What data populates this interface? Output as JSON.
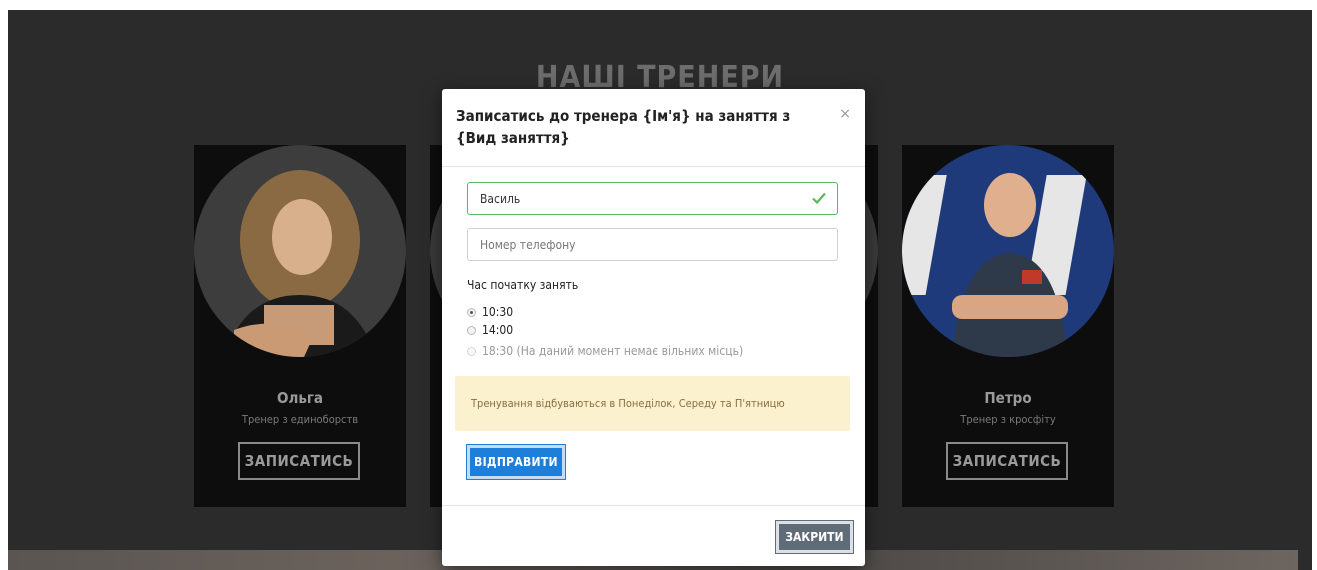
{
  "page": {
    "section_title": "НАШІ ТРЕНЕРИ",
    "trainers": [
      {
        "name": "Ольга",
        "role": "Тренер з единоборств",
        "button": "ЗАПИСАТИСЬ"
      },
      {
        "name": "",
        "role": "",
        "button": ""
      },
      {
        "name": "",
        "role": "",
        "button": ""
      },
      {
        "name": "Петро",
        "role": "Тренер з кросфіту",
        "button": "ЗАПИСАТИСЬ"
      }
    ]
  },
  "modal": {
    "title": "Записатись до тренера {Ім'я} на заняття з {Вид заняття}",
    "close_symbol": "×",
    "name_value": "Василь",
    "phone_placeholder": "Номер телефону",
    "time_label": "Час початку занять",
    "times": [
      {
        "label": "10:30",
        "checked": true,
        "disabled": false
      },
      {
        "label": "14:00",
        "checked": false,
        "disabled": false
      },
      {
        "label": "18:30 (На даний момент немає вільних місць)",
        "checked": false,
        "disabled": true
      }
    ],
    "notice": "Тренування відбуваються в Понеділок, Середу та П'ятницю",
    "send_label": "ВІДПРАВИТИ",
    "close_label": "ЗАКРИТИ"
  },
  "colors": {
    "primary": "#1e7fdb",
    "secondary": "#606b78",
    "valid": "#5cb85c",
    "notice_bg": "#fcf1cf",
    "notice_text": "#8a6d3b"
  },
  "icons": [
    "check-icon",
    "close-icon"
  ]
}
